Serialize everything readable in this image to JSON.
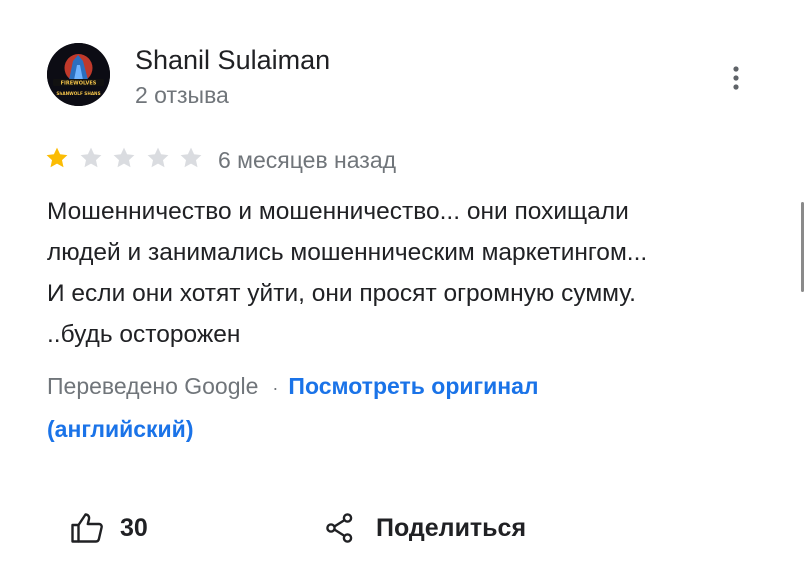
{
  "review": {
    "author": {
      "name": "Shanil Sulaiman",
      "reviews_count": "2 отзыва",
      "avatar_text_top": "FIREWOLVES",
      "avatar_text_bottom": "ShANWOLF SHANS"
    },
    "rating": {
      "value": 1,
      "max": 5
    },
    "date": "6 месяцев назад",
    "text_lines": [
      "Мошенничество и мошенничество... они похищали",
      "людей и занимались мошенническим маркетингом...",
      "И если они хотят уйти, они просят огромную сумму.",
      "..будь осторожен"
    ],
    "translation": {
      "label": "Переведено Google",
      "separator": "·",
      "link_line1": "Посмотреть оригинал",
      "link_line2": "(английский)"
    },
    "actions": {
      "like_count": "30",
      "share_label": "Поделиться"
    }
  },
  "icons": {
    "more": "more-vert-icon",
    "star": "star-icon",
    "like": "thumb-up-icon",
    "share": "share-icon"
  },
  "colors": {
    "star_filled": "#fbbc04",
    "star_empty": "#dadce0",
    "link": "#1a73e8",
    "secondary_text": "#70757a"
  }
}
